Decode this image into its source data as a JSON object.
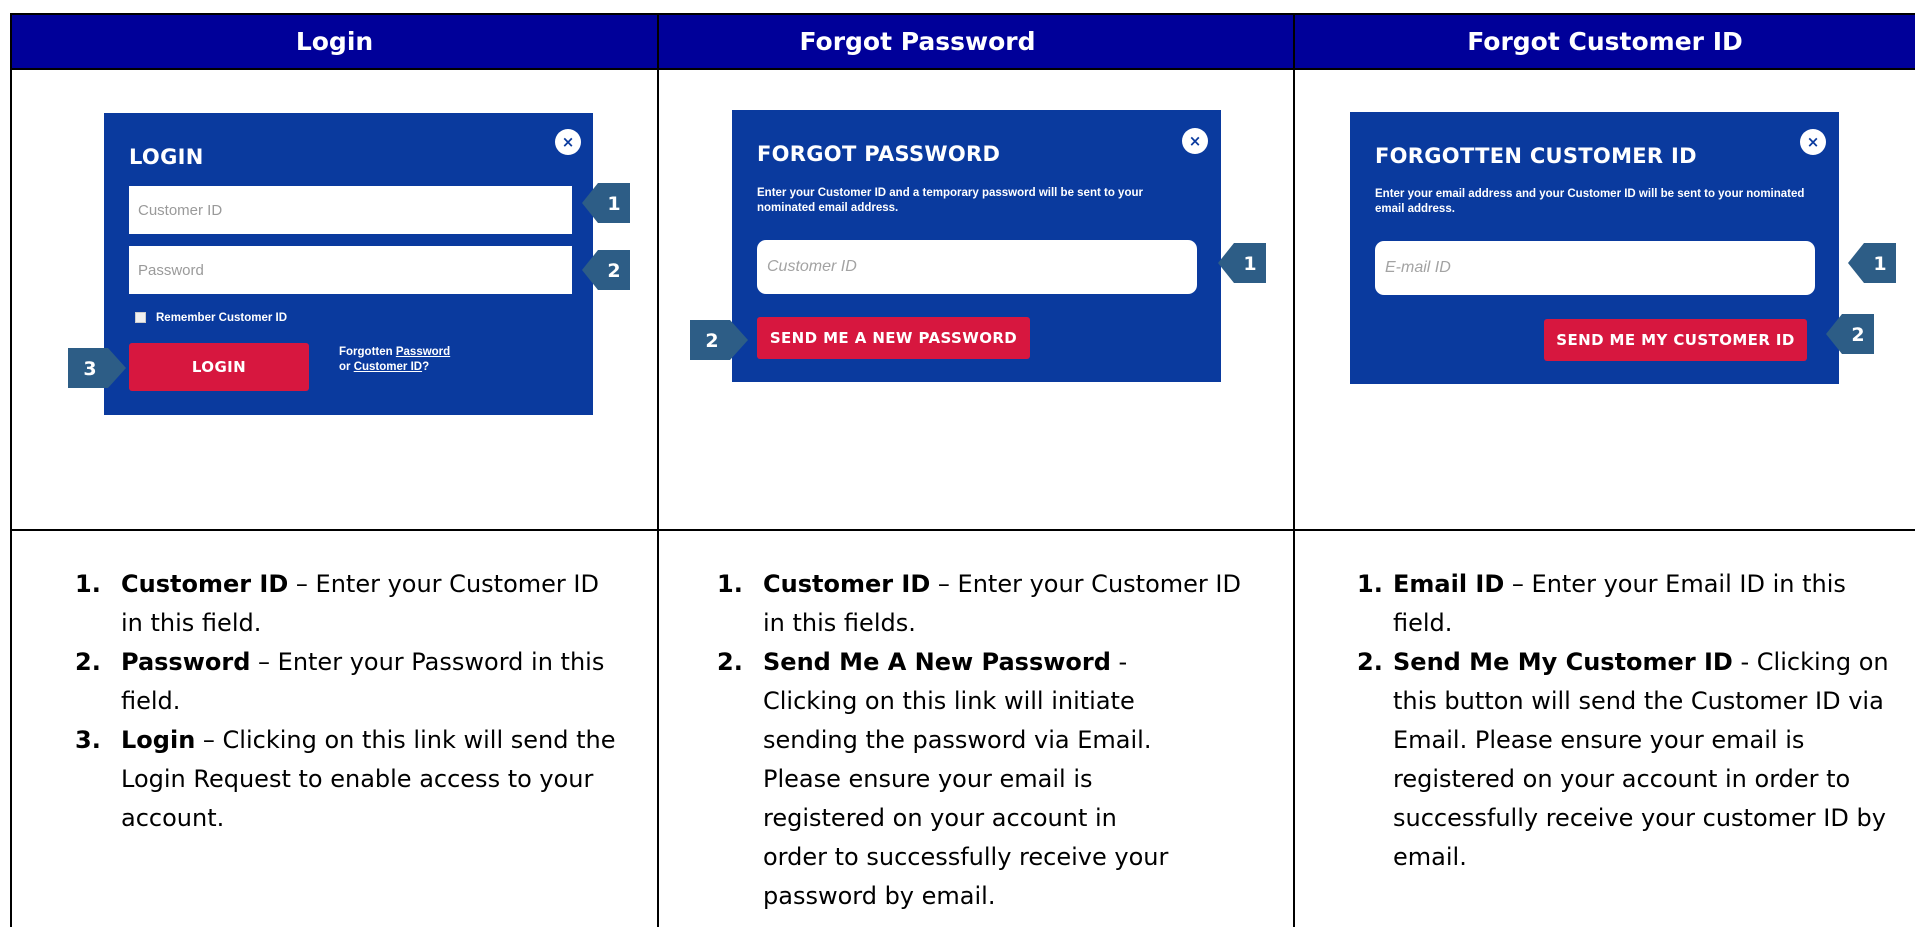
{
  "columns": [
    {
      "header": "Login",
      "shot": {
        "title": "LOGIN",
        "close": "×",
        "customer_id_placeholder": "Customer ID",
        "password_placeholder": "Password",
        "remember_label": "Remember Customer ID",
        "login_button": "LOGIN",
        "forgotten_text": "Forgotten",
        "password_link": "Password",
        "or_text": "or",
        "customer_id_link": "Customer ID",
        "question_mark": "?"
      },
      "callouts": [
        "1",
        "2",
        "3"
      ],
      "items": [
        {
          "num": "1.",
          "term": "Customer ID",
          "text": " – Enter your Customer ID in this field."
        },
        {
          "num": "2.",
          "term": "Password",
          "text": " – Enter your Password in this field."
        },
        {
          "num": "3.",
          "term": "Login",
          "text": " – Clicking on this link will send the Login Request to enable access to your account."
        }
      ]
    },
    {
      "header": "Forgot Password",
      "shot": {
        "title": "FORGOT PASSWORD",
        "close": "×",
        "instructions": "Enter your Customer ID and a temporary password will be sent to your nominated email address.",
        "customer_id_placeholder": "Customer ID",
        "send_button": "SEND ME A NEW PASSWORD"
      },
      "callouts": [
        "1",
        "2"
      ],
      "items": [
        {
          "num": "1.",
          "term": "Customer ID",
          "text": " – Enter your Customer ID in this fields."
        },
        {
          "num": "2.",
          "term": "Send Me A New Password",
          "text": " - Clicking on this link will initiate sending the password via Email. Please ensure your email is registered on your account in order to successfully receive your password by email."
        }
      ]
    },
    {
      "header": "Forgot Customer ID",
      "shot": {
        "title": "FORGOTTEN CUSTOMER ID",
        "close": "×",
        "instructions": "Enter your email address and your Customer ID will be sent to your nominated email address.",
        "email_placeholder": "E-mail ID",
        "send_button": "SEND ME MY CUSTOMER ID"
      },
      "callouts": [
        "1",
        "2"
      ],
      "items": [
        {
          "num": "1.",
          "term": "Email ID",
          "text": " – Enter your Email ID in this field."
        },
        {
          "num": "2.",
          "term": "Send Me My Customer ID",
          "text": " - Clicking on this button will send the Customer ID via Email. Please ensure your email is registered on your account in order to successfully receive your customer ID by email."
        }
      ]
    }
  ],
  "colors": {
    "header_bg": "#000099",
    "panel_bg": "#0a3a9e",
    "button_red": "#d7173f",
    "callout": "#2d5d86"
  }
}
